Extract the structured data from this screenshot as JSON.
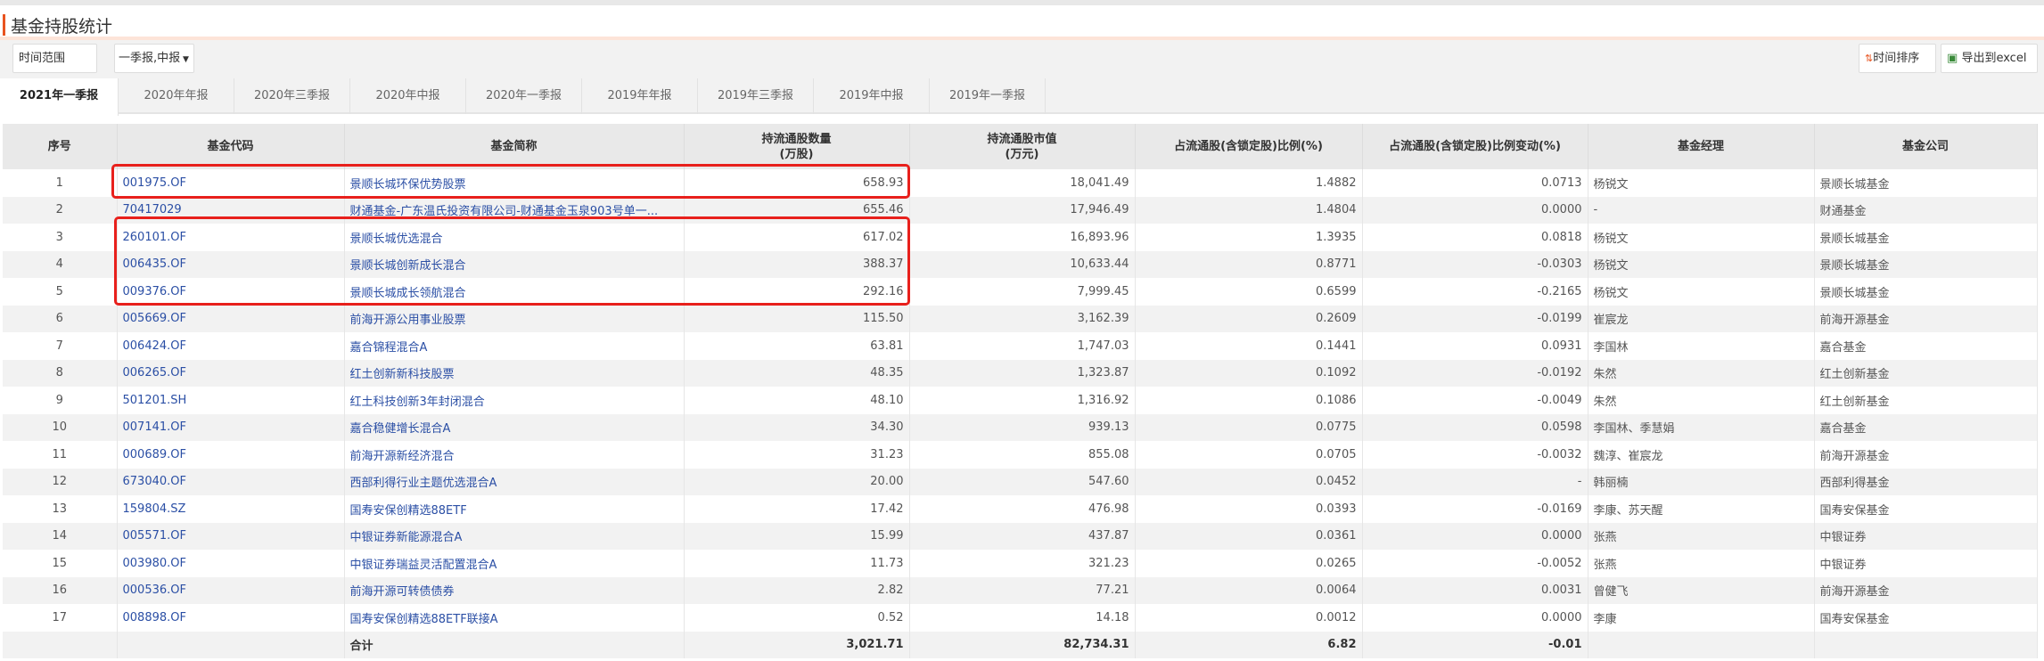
{
  "title": "基金持股统计",
  "toolbar": {
    "range_label": "时间范围",
    "range_value": "一季报,中报",
    "sort_label": "时间排序",
    "export_label": "导出到excel"
  },
  "tabs": [
    "2021年一季报",
    "2020年年报",
    "2020年三季报",
    "2020年中报",
    "2020年一季报",
    "2019年年报",
    "2019年三季报",
    "2019年中报",
    "2019年一季报"
  ],
  "active_tab": 0,
  "columns": [
    "序号",
    "基金代码",
    "基金简称",
    "持流通股数量\n(万股)",
    "持流通股市值\n(万元)",
    "占流通股(含锁定股)比例(%)",
    "占流通股(含锁定股)比例变动(%)",
    "基金经理",
    "基金公司"
  ],
  "rows": [
    [
      "1",
      "001975.OF",
      "景顺长城环保优势股票",
      "658.93",
      "18,041.49",
      "1.4882",
      "0.0713",
      "杨锐文",
      "景顺长城基金"
    ],
    [
      "2",
      "70417029",
      "财通基金-广东温氏投资有限公司-财通基金玉泉903号单一...",
      "655.46",
      "17,946.49",
      "1.4804",
      "0.0000",
      "-",
      "财通基金"
    ],
    [
      "3",
      "260101.OF",
      "景顺长城优选混合",
      "617.02",
      "16,893.96",
      "1.3935",
      "0.0818",
      "杨锐文",
      "景顺长城基金"
    ],
    [
      "4",
      "006435.OF",
      "景顺长城创新成长混合",
      "388.37",
      "10,633.44",
      "0.8771",
      "-0.0303",
      "杨锐文",
      "景顺长城基金"
    ],
    [
      "5",
      "009376.OF",
      "景顺长城成长领航混合",
      "292.16",
      "7,999.45",
      "0.6599",
      "-0.2165",
      "杨锐文",
      "景顺长城基金"
    ],
    [
      "6",
      "005669.OF",
      "前海开源公用事业股票",
      "115.50",
      "3,162.39",
      "0.2609",
      "-0.0199",
      "崔宸龙",
      "前海开源基金"
    ],
    [
      "7",
      "006424.OF",
      "嘉合锦程混合A",
      "63.81",
      "1,747.03",
      "0.1441",
      "0.0931",
      "李国林",
      "嘉合基金"
    ],
    [
      "8",
      "006265.OF",
      "红土创新新科技股票",
      "48.35",
      "1,323.87",
      "0.1092",
      "-0.0192",
      "朱然",
      "红土创新基金"
    ],
    [
      "9",
      "501201.SH",
      "红土科技创新3年封闭混合",
      "48.10",
      "1,316.92",
      "0.1086",
      "-0.0049",
      "朱然",
      "红土创新基金"
    ],
    [
      "10",
      "007141.OF",
      "嘉合稳健增长混合A",
      "34.30",
      "939.13",
      "0.0775",
      "0.0598",
      "李国林、季慧娟",
      "嘉合基金"
    ],
    [
      "11",
      "000689.OF",
      "前海开源新经济混合",
      "31.23",
      "855.08",
      "0.0705",
      "-0.0032",
      "魏淳、崔宸龙",
      "前海开源基金"
    ],
    [
      "12",
      "673040.OF",
      "西部利得行业主题优选混合A",
      "20.00",
      "547.60",
      "0.0452",
      "-",
      "韩丽楠",
      "西部利得基金"
    ],
    [
      "13",
      "159804.SZ",
      "国寿安保创精选88ETF",
      "17.42",
      "476.98",
      "0.0393",
      "-0.0169",
      "李康、苏天醒",
      "国寿安保基金"
    ],
    [
      "14",
      "005571.OF",
      "中银证券新能源混合A",
      "15.99",
      "437.87",
      "0.0361",
      "0.0000",
      "张燕",
      "中银证券"
    ],
    [
      "15",
      "003980.OF",
      "中银证券瑞益灵活配置混合A",
      "11.73",
      "321.23",
      "0.0265",
      "-0.0052",
      "张燕",
      "中银证券"
    ],
    [
      "16",
      "000536.OF",
      "前海开源可转债债券",
      "2.82",
      "77.21",
      "0.0064",
      "0.0031",
      "曾健飞",
      "前海开源基金"
    ],
    [
      "17",
      "008898.OF",
      "国寿安保创精选88ETF联接A",
      "0.52",
      "14.18",
      "0.0012",
      "0.0000",
      "李康",
      "国寿安保基金"
    ]
  ],
  "total": {
    "label": "合计",
    "shares": "3,021.71",
    "value": "82,734.31",
    "ratio": "6.82",
    "change": "-0.01"
  },
  "colors": {
    "accent": "#e8531f",
    "link": "#2b4fa5",
    "highlight": "#e8201c"
  }
}
